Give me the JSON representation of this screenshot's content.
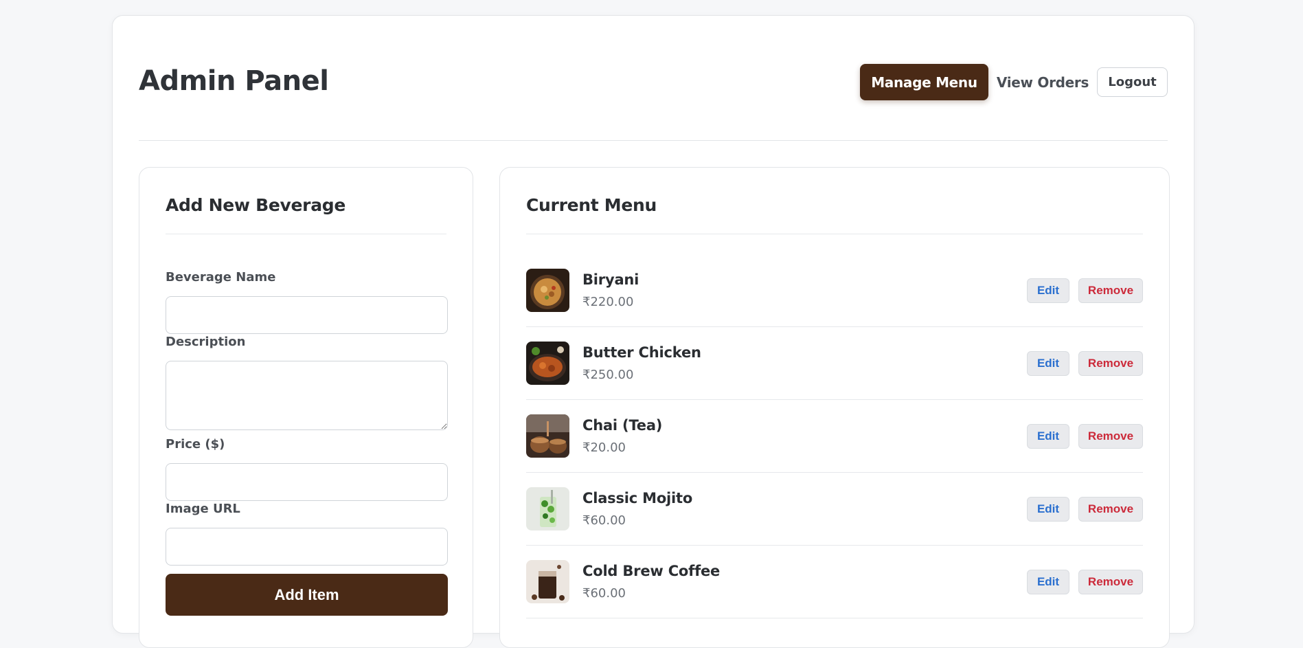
{
  "header": {
    "title": "Admin Panel",
    "nav": {
      "manage_menu": "Manage Menu",
      "view_orders": "View Orders",
      "logout": "Logout"
    }
  },
  "add_form": {
    "title": "Add New Beverage",
    "fields": {
      "name_label": "Beverage Name",
      "name_value": "",
      "description_label": "Description",
      "description_value": "",
      "price_label": "Price ($)",
      "price_value": "",
      "image_label": "Image URL",
      "image_value": ""
    },
    "submit_label": "Add Item"
  },
  "menu": {
    "title": "Current Menu",
    "edit_label": "Edit",
    "remove_label": "Remove",
    "items": [
      {
        "name": "Biryani",
        "price": "₹220.00",
        "thumb": "biryani-photo"
      },
      {
        "name": "Butter Chicken",
        "price": "₹250.00",
        "thumb": "butter-chicken-photo"
      },
      {
        "name": "Chai (Tea)",
        "price": "₹20.00",
        "thumb": "chai-photo"
      },
      {
        "name": "Classic Mojito",
        "price": "₹60.00",
        "thumb": "mojito-photo"
      },
      {
        "name": "Cold Brew Coffee",
        "price": "₹60.00",
        "thumb": "cold-brew-photo"
      }
    ]
  },
  "colors": {
    "brand": "#4a2a16",
    "edit": "#2a6fcf",
    "remove": "#cc2a3a"
  }
}
